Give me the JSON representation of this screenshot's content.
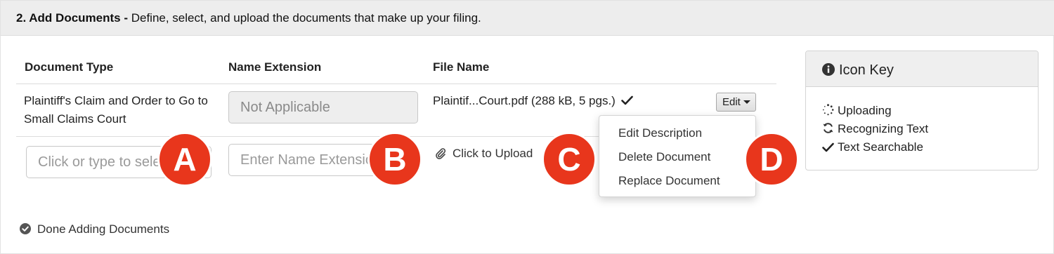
{
  "header": {
    "step_title": "2. Add Documents -",
    "description": " Define, select, and upload the documents that make up your filing."
  },
  "table": {
    "columns": [
      "Document Type",
      "Name Extension",
      "File Name"
    ],
    "row1": {
      "document_type": "Plaintiff's Claim and Order to Go to Small Claims Court",
      "name_extension": "Not Applicable",
      "file_name": "Plaintif...Court.pdf (288 kB, 5 pgs.)",
      "edit_label": "Edit"
    },
    "row2": {
      "document_type_placeholder": "Click or type to select",
      "name_extension_placeholder": "Enter Name Extension",
      "upload_label": "Click to Upload"
    }
  },
  "edit_menu": [
    "Edit Description",
    "Delete Document",
    "Replace Document"
  ],
  "done_label": "Done Adding Documents",
  "icon_key": {
    "title": "Icon Key",
    "items": [
      "Uploading",
      "Recognizing Text",
      "Text Searchable"
    ]
  },
  "callouts": [
    "A",
    "B",
    "C",
    "D"
  ],
  "colors": {
    "callout": "#e8361c",
    "header_bg": "#ededed"
  }
}
